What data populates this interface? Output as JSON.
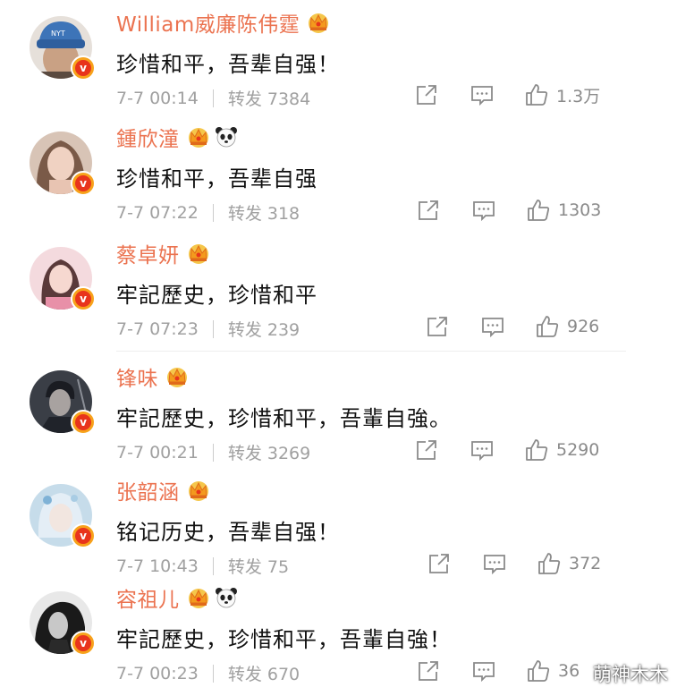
{
  "comments": [
    {
      "name": "William威廉陈伟霆",
      "text": "珍惜和平，吾辈自强！",
      "time": "7-7 00:14",
      "repost": "转发 7384",
      "likes": "1.3万",
      "badges": [
        "crown-icon"
      ],
      "avatar_colors": [
        "#3d74b8",
        "#c49a7a"
      ]
    },
    {
      "name": "鍾欣潼",
      "text": "珍惜和平，吾辈自强",
      "time": "7-7 07:22",
      "repost": "转发 318",
      "likes": "1303",
      "badges": [
        "crown-icon",
        "panda-icon"
      ],
      "avatar_colors": [
        "#8a6a58",
        "#e8c8b8"
      ]
    },
    {
      "name": "蔡卓妍",
      "text": "牢記歷史，珍惜和平",
      "time": "7-7 07:23",
      "repost": "转发 239",
      "likes": "926",
      "badges": [
        "crown-icon"
      ],
      "avatar_colors": [
        "#e8a8b8",
        "#f4d4d8"
      ]
    },
    {
      "name": "锋味",
      "text": "牢記歷史，珍惜和平，吾輩自強。",
      "time": "7-7 00:21",
      "repost": "转发 3269",
      "likes": "5290",
      "badges": [
        "crown-icon"
      ],
      "avatar_colors": [
        "#2a2e36",
        "#7a7e86"
      ]
    },
    {
      "name": "张韶涵",
      "text": "铭记历史，吾辈自强！",
      "time": "7-7 10:43",
      "repost": "转发 75",
      "likes": "372",
      "badges": [
        "crown-icon"
      ],
      "avatar_colors": [
        "#9fc2d8",
        "#e8eef4"
      ]
    },
    {
      "name": "容祖儿",
      "text": "牢記歷史，珍惜和平，吾輩自強！",
      "time": "7-7 00:23",
      "repost": "转发 670",
      "likes": "36",
      "badges": [
        "crown-icon",
        "panda-icon"
      ],
      "avatar_colors": [
        "#1e1e1e",
        "#8a8a8a"
      ]
    }
  ],
  "verified_badge": "v",
  "watermark": "萌神木木",
  "colors": {
    "name": "#eb7350",
    "text": "#111111",
    "meta": "#a0a0a0",
    "icon": "#8a8a8a",
    "badge_ring": "#f7a21b",
    "badge": "#e8341c"
  }
}
